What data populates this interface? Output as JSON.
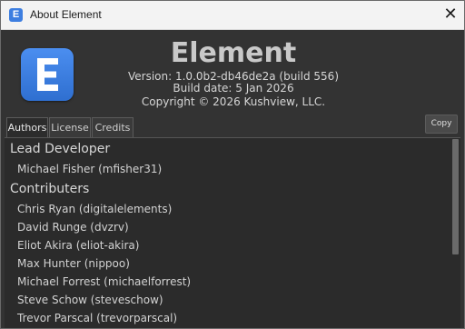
{
  "window": {
    "title": "About Element",
    "app_icon_letter": "E",
    "close_glyph": "✕"
  },
  "header": {
    "app_name": "Element",
    "version": "Version: 1.0.0b2-db46de2a (build 556)",
    "build_date": "Build date: 5 Jan 2026",
    "copyright": "Copyright © 2026 Kushview, LLC."
  },
  "tabs": [
    {
      "label": "Authors",
      "active": true
    },
    {
      "label": "License",
      "active": false
    },
    {
      "label": "Credits",
      "active": false
    }
  ],
  "copy_button": {
    "label": "Copy"
  },
  "authors": {
    "lead_heading": "Lead Developer",
    "lead": [
      "Michael Fisher (mfisher31)"
    ],
    "contributors_heading": "Contributers",
    "contributors": [
      "Chris Ryan (digitalelements)",
      "David Runge (dvzrv)",
      "Eliot Akira (eliot-akira)",
      "Max Hunter (nippoo)",
      "Michael Forrest (michaelforrest)",
      "Steve Schow (steveschow)",
      "Trevor Parscal (trevorparscal)"
    ]
  },
  "colors": {
    "logo_blue": "#3d7ee0",
    "background": "#333333",
    "panel": "#2b2b2b"
  },
  "icons": {
    "app": "element-app-icon",
    "logo": "element-logo-icon",
    "close": "close-icon"
  }
}
